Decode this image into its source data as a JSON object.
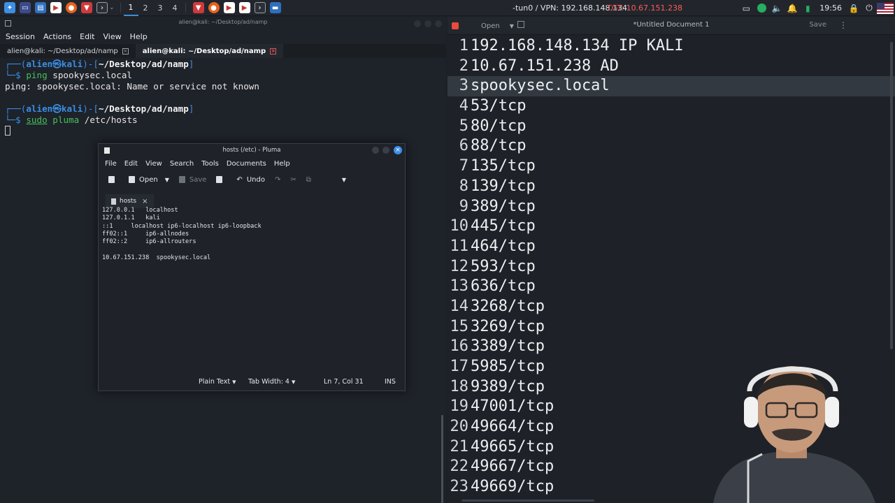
{
  "topbar": {
    "workspaces": [
      "1",
      "2",
      "3",
      "4"
    ],
    "vpn_label": "-tun0 / VPN:",
    "vpn_ip": "192.168.148.134",
    "tgt_label": "TGT: 10.67.151.238",
    "clock": "19:56"
  },
  "terminal": {
    "title": "alien@kali: ~/Desktop/ad/namp",
    "menu": [
      "Session",
      "Actions",
      "Edit",
      "View",
      "Help"
    ],
    "tabs": [
      "alien@kali: ~/Desktop/ad/namp",
      "alien@kali: ~/Desktop/ad/namp"
    ],
    "prompt_user": "alien",
    "prompt_host": "kali",
    "prompt_path": "~/Desktop/ad/namp",
    "cmd1_bin": "ping",
    "cmd1_args": " spookysec.local",
    "output1": "ping: spookysec.local: Name or service not known",
    "cmd2_bin": "sudo",
    "cmd2_tool": "pluma",
    "cmd2_args": " /etc/hosts"
  },
  "pluma": {
    "title": "hosts (/etc) - Pluma",
    "menu": [
      "File",
      "Edit",
      "View",
      "Search",
      "Tools",
      "Documents",
      "Help"
    ],
    "toolbar": {
      "open": "Open",
      "save": "Save",
      "undo": "Undo"
    },
    "tab": "hosts",
    "content": "127.0.0.1   localhost\n127.0.1.1   kali\n::1     localhost ip6-localhost ip6-loopback\nff02::1     ip6-allnodes\nff02::2     ip6-allrouters\n\n10.67.151.238  spookysec.local",
    "status": {
      "mode": "Plain Text",
      "tab_width": "Tab Width:  4",
      "position": "Ln 7, Col 31",
      "ins": "INS"
    }
  },
  "editor": {
    "open": "Open",
    "title": "*Untitled Document 1",
    "save": "Save",
    "lines": [
      "192.168.148.134 IP KALI",
      "10.67.151.238 AD",
      "spookysec.local",
      "53/tcp",
      "80/tcp",
      "88/tcp",
      "135/tcp",
      "139/tcp",
      "389/tcp",
      "445/tcp",
      "464/tcp",
      "593/tcp",
      "636/tcp",
      "3268/tcp",
      "3269/tcp",
      "3389/tcp",
      "5985/tcp",
      "9389/tcp",
      "47001/tcp",
      "49664/tcp",
      "49665/tcp",
      "49667/tcp",
      "49669/tcp"
    ],
    "current_line": 3
  },
  "icons": {
    "colors": {
      "accent": "#3d8fe6",
      "prompt": "#3a8ee6",
      "command": "#47c15b",
      "target": "#ff5a5a"
    }
  }
}
